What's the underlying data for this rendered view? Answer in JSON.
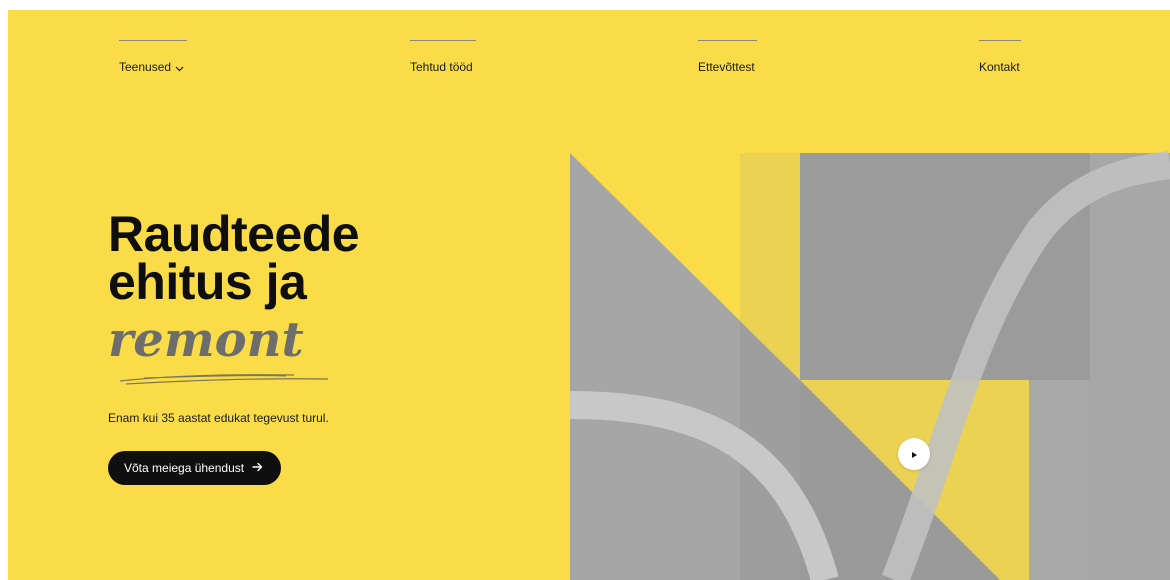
{
  "nav": {
    "items": [
      {
        "label": "Teenused",
        "has_dropdown": true
      },
      {
        "label": "Tehtud tööd"
      },
      {
        "label": "Ettevõttest"
      },
      {
        "label": "Kontakt"
      }
    ]
  },
  "hero": {
    "title_line1": "Raudteede",
    "title_line2": "ehitus ja",
    "title_accent": "remont",
    "subtitle": "Enam kui 35 aastat edukat tegevust turul.",
    "cta_label": "Võta meiega ühendust"
  },
  "colors": {
    "background": "#f9dc47",
    "text": "#0e0e0e",
    "accent_text": "#6d6d6d",
    "button": "#0f0f0f",
    "art_gray": "#a6a6a6"
  },
  "icons": {
    "dropdown": "chevron-down-icon",
    "cta": "arrow-right-icon",
    "video": "play-icon"
  }
}
